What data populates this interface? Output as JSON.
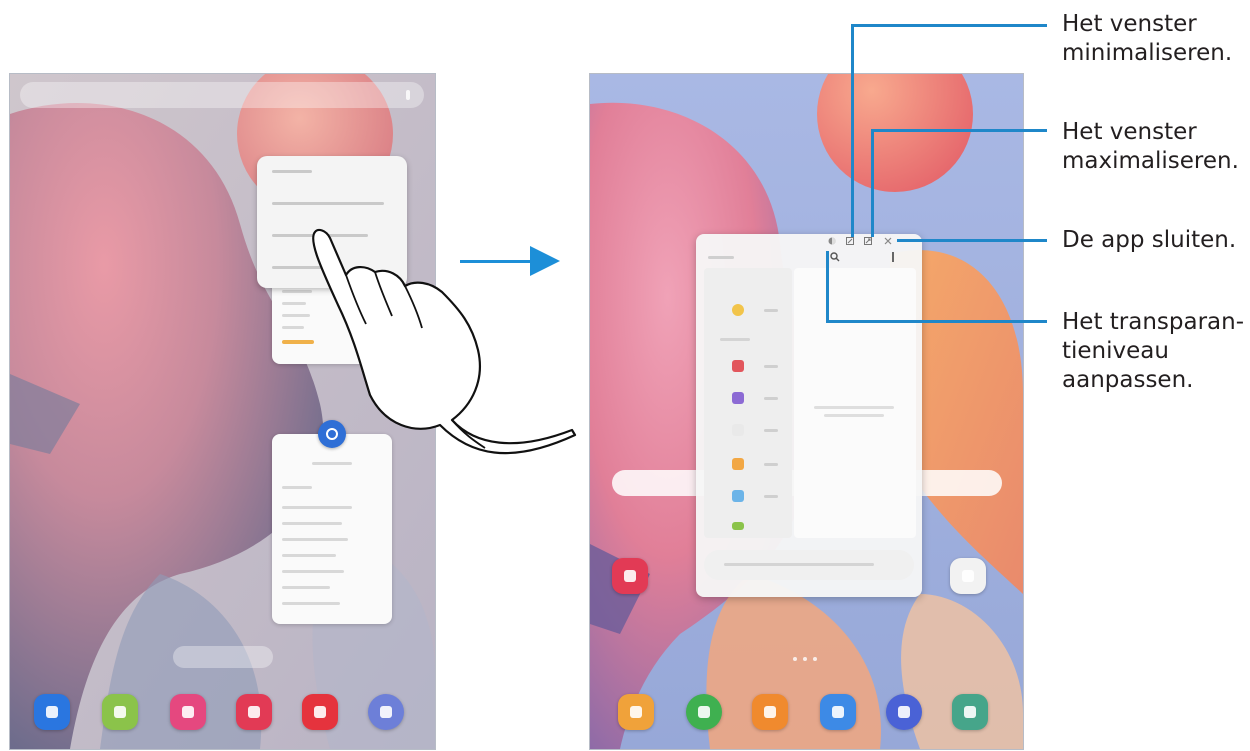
{
  "callouts": {
    "minimize": {
      "line1": "Het venster",
      "line2": "minimaliseren."
    },
    "maximize": {
      "line1": "Het venster",
      "line2": "maximaliseren."
    },
    "close": {
      "line1": "De app sluiten."
    },
    "transparency": {
      "line1": "Het transparan-",
      "line2": "tieniveau",
      "line3": "aanpassen."
    }
  },
  "colors": {
    "callout_line": "#1f87c9",
    "arrow": "#1d8fd8",
    "text": "#231f20"
  },
  "icons": {
    "arrow": "right-arrow-icon",
    "hand": "pointing-hand-icon",
    "transparency": "transparency-icon",
    "minimize": "minimize-icon",
    "maximize": "maximize-icon",
    "close": "close-icon",
    "settings": "settings-icon"
  }
}
